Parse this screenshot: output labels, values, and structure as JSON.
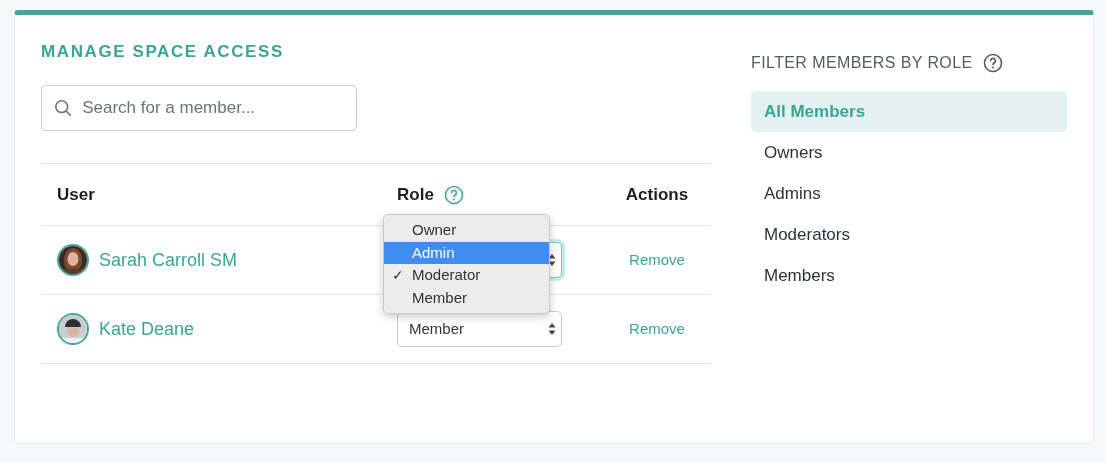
{
  "title": "MANAGE SPACE ACCESS",
  "search": {
    "placeholder": "Search for a member..."
  },
  "table": {
    "columns": [
      "User",
      "Role",
      "Actions"
    ],
    "rows": [
      {
        "name": "Sarah Carroll SM",
        "role": {
          "open": true,
          "focused": true,
          "check": "✓",
          "options": [
            {
              "label": "Owner",
              "checked": false,
              "highlighted": false
            },
            {
              "label": "Admin",
              "checked": false,
              "highlighted": true
            },
            {
              "label": "Moderator",
              "checked": true,
              "highlighted": false
            },
            {
              "label": "Member",
              "checked": false,
              "highlighted": false
            }
          ]
        },
        "action": "Remove"
      },
      {
        "name": "Kate Deane",
        "role": {
          "focused": false,
          "value": "Member"
        },
        "action": "Remove"
      }
    ]
  },
  "filter": {
    "title": "FILTER MEMBERS BY ROLE",
    "items": [
      {
        "label": "All Members",
        "selected": true
      },
      {
        "label": "Owners",
        "selected": false
      },
      {
        "label": "Admins",
        "selected": false
      },
      {
        "label": "Moderators",
        "selected": false
      },
      {
        "label": "Members",
        "selected": false
      }
    ]
  }
}
